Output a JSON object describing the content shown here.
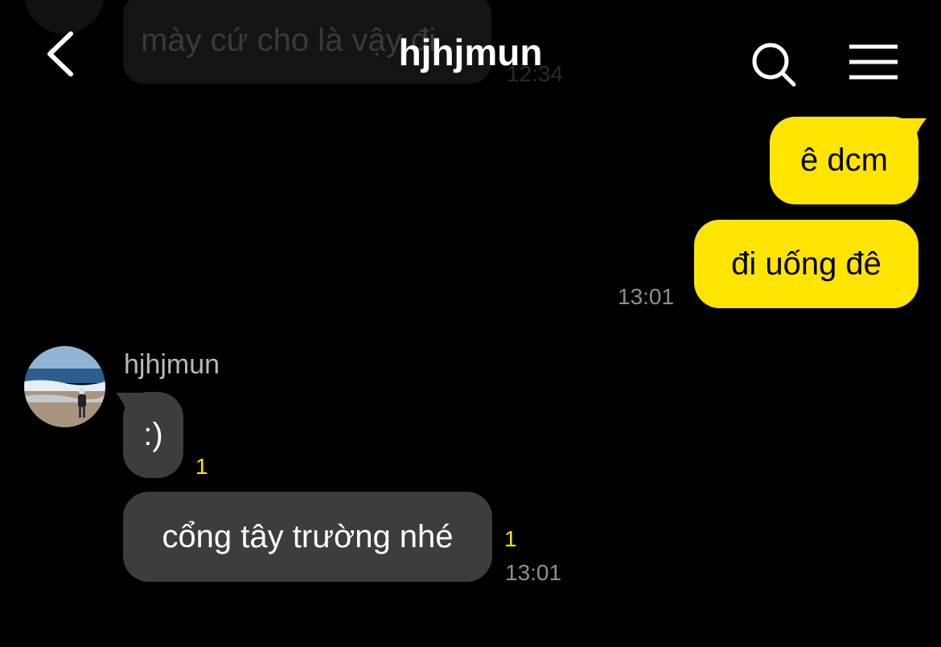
{
  "header": {
    "title": "hjhjmun"
  },
  "icons": {
    "back": "chevron-left-icon",
    "search": "search-icon",
    "menu": "hamburger-menu-icon"
  },
  "colors": {
    "outgoing_bubble": "#fee500",
    "incoming_bubble": "#3d3d3d",
    "unread_count": "#fee500",
    "background": "#000000"
  },
  "previous_message": {
    "text": "mày cứ cho là vậy đi",
    "time": "12:34"
  },
  "outgoing": {
    "messages": [
      {
        "text": "ê dcm"
      },
      {
        "text": "đi uống đê"
      }
    ],
    "time": "13:01"
  },
  "incoming": {
    "sender": "hjhjmun",
    "messages": [
      {
        "text": ":)",
        "unread": "1"
      },
      {
        "text": "cổng tây trường nhé",
        "unread": "1",
        "time": "13:01"
      }
    ]
  }
}
